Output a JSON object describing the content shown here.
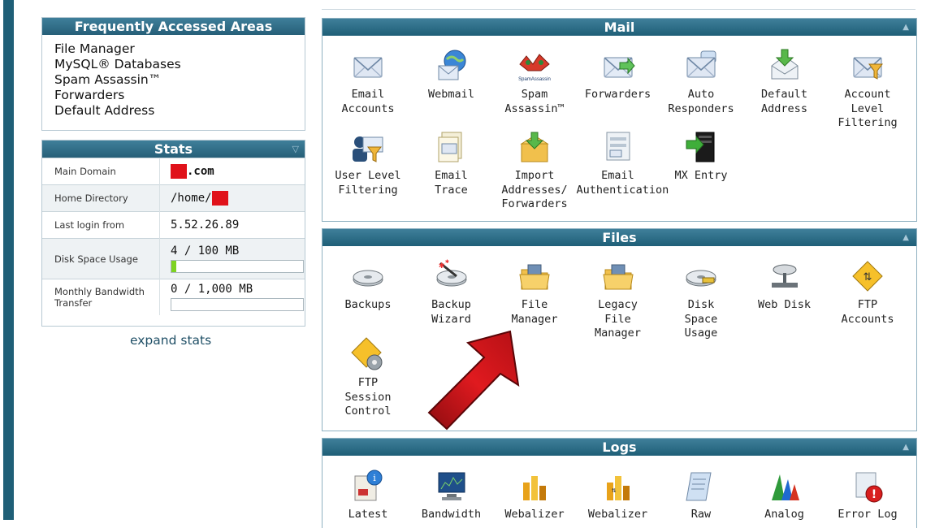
{
  "frequently_accessed": {
    "title": "Frequently Accessed Areas",
    "items": [
      "File Manager",
      "MySQL® Databases",
      "Spam Assassin™",
      "Forwarders",
      "Default Address"
    ]
  },
  "stats": {
    "title": "Stats",
    "rows": [
      {
        "label": "Main Domain",
        "value": ".com"
      },
      {
        "label": "Home Directory",
        "value": "/home/"
      },
      {
        "label": "Last login from",
        "value": "5.52.26.89"
      },
      {
        "label": "Disk Space Usage",
        "value": "4 / 100 MB",
        "usage_fraction": 0.04
      },
      {
        "label": "Monthly Bandwidth Transfer",
        "value": "0 / 1,000 MB",
        "usage_fraction": 0.0
      }
    ],
    "expand_link": "expand stats"
  },
  "sections": {
    "mail": {
      "title": "Mail",
      "items": [
        {
          "label": "Email\nAccounts",
          "icon": "envelope-icon"
        },
        {
          "label": "Webmail",
          "icon": "globe-envelope-icon"
        },
        {
          "label": "Spam\nAssassin™",
          "icon": "spamassassin-icon"
        },
        {
          "label": "Forwarders",
          "icon": "forward-envelope-icon"
        },
        {
          "label": "Auto\nResponders",
          "icon": "autoresponder-icon"
        },
        {
          "label": "Default\nAddress",
          "icon": "default-address-icon"
        },
        {
          "label": "Account\nLevel\nFiltering",
          "icon": "funnel-envelope-icon"
        },
        {
          "label": "User Level\nFiltering",
          "icon": "user-funnel-icon"
        },
        {
          "label": "Email\nTrace",
          "icon": "trace-document-icon"
        },
        {
          "label": "Import\nAddresses/\nForwarders",
          "icon": "import-box-icon"
        },
        {
          "label": "Email\nAuthentication",
          "icon": "auth-envelope-icon"
        },
        {
          "label": "MX Entry",
          "icon": "mx-server-icon"
        }
      ]
    },
    "files": {
      "title": "Files",
      "items": [
        {
          "label": "Backups",
          "icon": "disk-icon"
        },
        {
          "label": "Backup\nWizard",
          "icon": "wizard-wand-icon"
        },
        {
          "label": "File\nManager",
          "icon": "folder-icon"
        },
        {
          "label": "Legacy\nFile\nManager",
          "icon": "legacy-folder-icon"
        },
        {
          "label": "Disk\nSpace\nUsage",
          "icon": "disk-usage-icon"
        },
        {
          "label": "Web Disk",
          "icon": "web-disk-icon"
        },
        {
          "label": "FTP\nAccounts",
          "icon": "ftp-arrows-icon"
        },
        {
          "label": "FTP\nSession\nControl",
          "icon": "ftp-gear-icon"
        }
      ]
    },
    "logs": {
      "title": "Logs",
      "items": [
        {
          "label": "Latest",
          "icon": "info-log-icon"
        },
        {
          "label": "Bandwidth",
          "icon": "monitor-chart-icon"
        },
        {
          "label": "Webalizer",
          "icon": "webalizer-bars-icon"
        },
        {
          "label": "Webalizer",
          "icon": "webalizer-ftp-icon"
        },
        {
          "label": "Raw",
          "icon": "raw-log-icon"
        },
        {
          "label": "Analog",
          "icon": "analog-bars-icon"
        },
        {
          "label": "Error Log",
          "icon": "error-log-icon"
        }
      ]
    }
  },
  "colors": {
    "header": "#1f5f77",
    "redaction": "#e0121a",
    "arrow": "#d3151a"
  }
}
